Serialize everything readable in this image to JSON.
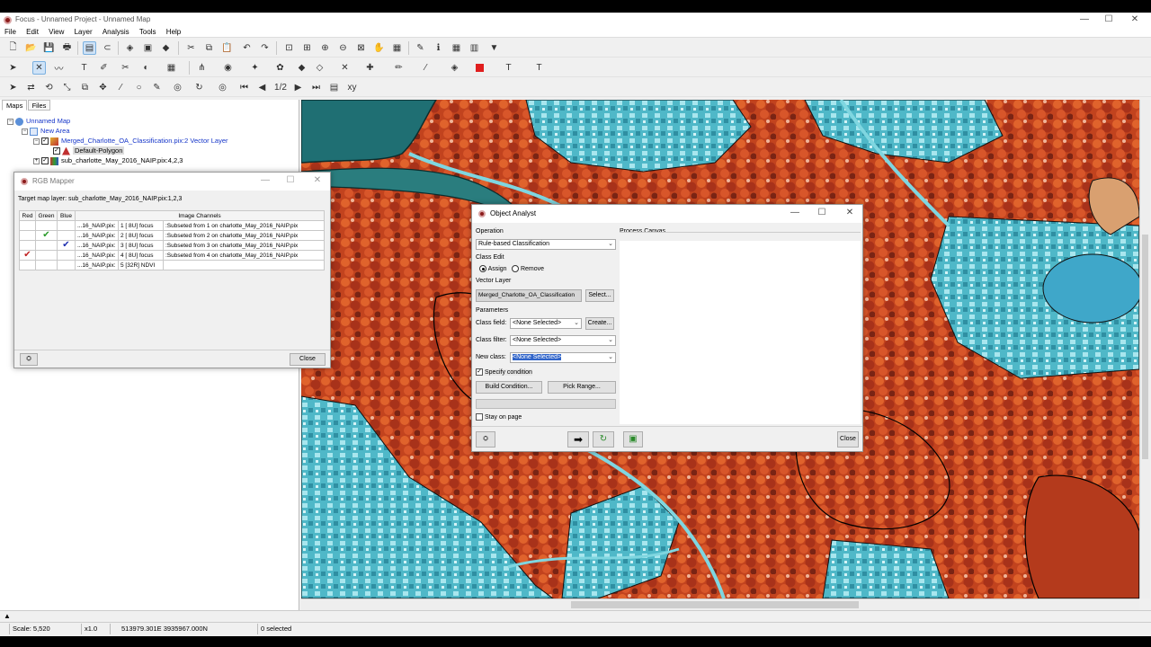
{
  "window": {
    "title": "Focus - Unnamed Project - Unnamed Map",
    "controls": {
      "minimize": "—",
      "maximize": "☐",
      "close": "✕"
    }
  },
  "menu": [
    "File",
    "Edit",
    "View",
    "Layer",
    "Analysis",
    "Tools",
    "Help"
  ],
  "toolbar": {
    "zoom_fraction": "1/2"
  },
  "left_panel": {
    "tabs": [
      "Maps",
      "Files"
    ],
    "tree": {
      "map": "Unnamed Map",
      "area": "New Area",
      "vector_layer": "Merged_Charlotte_OA_Classification.pix:2 Vector Layer",
      "default_polygon": "Default-Polygon",
      "raster_layer": "sub_charlotte_May_2016_NAIP.pix:4,2,3"
    }
  },
  "rgb_mapper": {
    "title": "RGB Mapper",
    "target_label": "Target map layer:  sub_charlotte_May_2016_NAIP.pix:1,2,3",
    "columns": [
      "Red",
      "Green",
      "Blue",
      "Image Channels"
    ],
    "rows": [
      {
        "red": "",
        "green": "",
        "blue": "",
        "file": "...16_NAIP.pix:",
        "chan": "1 [ 8U] focus",
        "desc": ":Subseted from 1 on charlotte_May_2016_NAIP.pix"
      },
      {
        "red": "",
        "green": "✔",
        "blue": "",
        "file": "...16_NAIP.pix:",
        "chan": "2 [ 8U] focus",
        "desc": ":Subseted from 2 on charlotte_May_2016_NAIP.pix"
      },
      {
        "red": "",
        "green": "",
        "blue": "✔",
        "file": "...16_NAIP.pix:",
        "chan": "3 [ 8U] focus",
        "desc": ":Subseted from 3 on charlotte_May_2016_NAIP.pix"
      },
      {
        "red": "✔",
        "green": "",
        "blue": "",
        "file": "...16_NAIP.pix:",
        "chan": "4 [ 8U] focus",
        "desc": ":Subseted from 4 on charlotte_May_2016_NAIP.pix"
      },
      {
        "red": "",
        "green": "",
        "blue": "",
        "file": "...16_NAIP.pix:",
        "chan": "5 [32R] NDVI",
        "desc": ""
      }
    ],
    "close_label": "Close"
  },
  "object_analyst": {
    "title": "Object Analyst",
    "operation_label": "Operation",
    "operation_value": "Rule-based Classification",
    "class_edit_label": "Class Edit",
    "assign_label": "Assign",
    "remove_label": "Remove",
    "vector_layer_label": "Vector Layer",
    "vector_layer_value": "Merged_Charlotte_OA_Classification",
    "select_label": "Select...",
    "parameters_label": "Parameters",
    "class_field_label": "Class field:",
    "class_field_value": "<None Selected>",
    "create_label": "Create...",
    "class_filter_label": "Class filter:",
    "class_filter_value": "<None Selected>",
    "new_class_label": "New class:",
    "new_class_value": "<None Selected>",
    "specify_condition_label": "Specify condition",
    "build_condition_label": "Build Condition...",
    "pick_range_label": "Pick Range...",
    "stay_on_page_label": "Stay on page",
    "process_canvas_label": "Process Canvas",
    "close_label": "Close"
  },
  "status": {
    "scale": "Scale: 5,520",
    "zoom": "x1.0",
    "coords": "513979.301E 3935967.000N",
    "selected": "0 selected"
  },
  "colors": {
    "vegetation": "#c8431c",
    "urban": "#49b9c9",
    "water": "#1f6f73",
    "selection": "#3064c9"
  }
}
